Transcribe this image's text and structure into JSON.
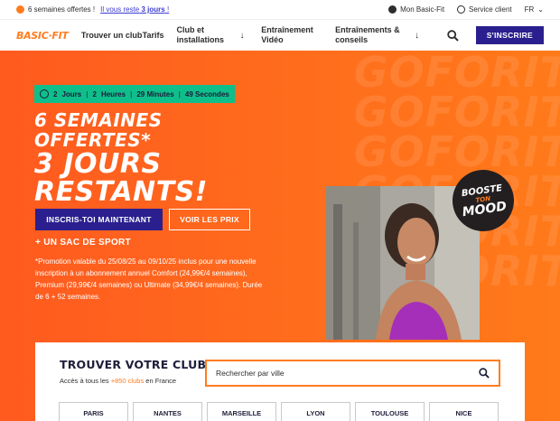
{
  "topbar": {
    "promo": "6 semaines offertes !",
    "promo_sub_prefix": "Il vous reste",
    "promo_sub_bold": "3 jours",
    "promo_sub_suffix": " !",
    "account": "Mon Basic-Fit",
    "service": "Service client",
    "lang": "FR"
  },
  "nav": {
    "logo": "BASIC·FIT",
    "items": [
      "Trouver un club",
      "Tarifs",
      "Club et installations",
      "Entraînement Vidéo",
      "Entraînements & conseils"
    ],
    "cta": "S'INSCRIRE"
  },
  "hero": {
    "watermark": [
      "GOFORIT",
      "GOFORIT",
      "GOFORIT",
      "GOFORIT",
      "GOFORIT",
      "GOFORIT"
    ],
    "timer": {
      "days_num": "2",
      "days_label": "Jours",
      "hours_num": "2",
      "hours_label": "Heures",
      "minutes": "29 Minutes",
      "seconds": "49 Secondes"
    },
    "line1": "6 SEMAINES",
    "line2": "OFFERTES*",
    "line3": "3 JOURS",
    "line4": "RESTANTS!",
    "primary_button": "INSCRIS-TOI MAINTENANT",
    "secondary_button": "VOIR LES PRIX",
    "bag": "+ UN SAC DE SPORT",
    "legal": "*Promotion valable du 25/08/25 au 09/10/25 inclus pour une nouvelle inscription à un abonnement annuel Comfort (24,99€/4 semaines), Premium (29,99€/4 semaines) ou Ultimate (34,99€/4 semaines). Durée de 6 + 52 semaines.",
    "badge": {
      "top": "BOOSTE",
      "mid": "TON",
      "bottom": "MOOD"
    }
  },
  "club_finder": {
    "title": "TROUVER VOTRE CLUB",
    "sub_prefix": "Accès à tous les ",
    "sub_highlight": "+850 clubs",
    "sub_suffix": " en France",
    "search_placeholder": "Rechercher par ville",
    "cities": [
      "PARIS",
      "NANTES",
      "MARSEILLE",
      "LYON",
      "TOULOUSE",
      "NICE"
    ]
  },
  "colors": {
    "brand_orange": "#ff7c1f",
    "brand_purple": "#2b1f8f",
    "timer_green": "#0fbf8b"
  }
}
